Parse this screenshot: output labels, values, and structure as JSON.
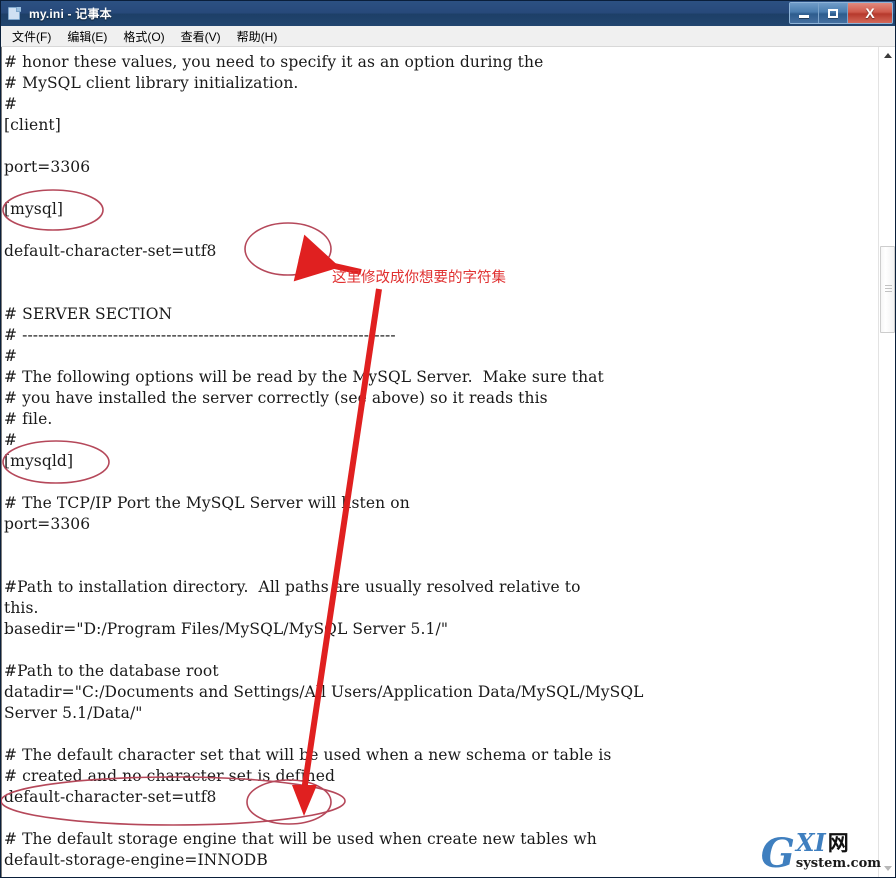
{
  "window": {
    "title": "my.ini - 记事本",
    "icon": "notepad-document-icon",
    "buttons": {
      "minimize": "—",
      "maximize": "□",
      "close": "X"
    }
  },
  "menubar": {
    "items": [
      {
        "label": "文件(F)",
        "name": "menu-file"
      },
      {
        "label": "编辑(E)",
        "name": "menu-edit"
      },
      {
        "label": "格式(O)",
        "name": "menu-format"
      },
      {
        "label": "查看(V)",
        "name": "menu-view"
      },
      {
        "label": "帮助(H)",
        "name": "menu-help"
      }
    ]
  },
  "editor": {
    "filename": "my.ini",
    "lines": [
      "# honor these values, you need to specify it as an option during the",
      "# MySQL client library initialization.",
      "#",
      "[client]",
      "",
      "port=3306",
      "",
      "[mysql]",
      "",
      "default-character-set=utf8",
      "",
      "",
      "# SERVER SECTION",
      "# ----------------------------------------------------------------------",
      "#",
      "# The following options will be read by the MySQL Server.  Make sure that",
      "# you have installed the server correctly (see above) so it reads this",
      "# file.",
      "#",
      "[mysqld]",
      "",
      "# The TCP/IP Port the MySQL Server will listen on",
      "port=3306",
      "",
      "",
      "#Path to installation directory.  All paths are usually resolved relative to",
      "this.",
      "basedir=\"D:/Program Files/MySQL/MySQL Server 5.1/\"",
      "",
      "#Path to the database root",
      "datadir=\"C:/Documents and Settings/All Users/Application Data/MySQL/MySQL",
      "Server 5.1/Data/\"",
      "",
      "# The default character set that will be used when a new schema or table is",
      "# created and no character set is defined",
      "default-character-set=utf8",
      "",
      "# The default storage engine that will be used when create new tables wh",
      "default-storage-engine=INNODB"
    ]
  },
  "annotations": {
    "note_text": "这里修改成你想要的字符集",
    "color_ellipse": "#b5485a",
    "color_arrow": "#e02020",
    "color_note": "#e03030",
    "ellipses": [
      {
        "name": "ellipse-mysql-section",
        "label": "[mysql]"
      },
      {
        "name": "ellipse-client-charset",
        "label": "default-character-set=utf8"
      },
      {
        "name": "ellipse-mysqld-section",
        "label": "[mysqld]"
      },
      {
        "name": "ellipse-server-charset",
        "label": "default-character-set=utf8"
      }
    ]
  },
  "scrollbar": {
    "up_arrow": "▲",
    "down_arrow": "▼"
  },
  "watermark": {
    "g": "G",
    "xi": "XI",
    "cn": "网",
    "domain": "system.com"
  }
}
